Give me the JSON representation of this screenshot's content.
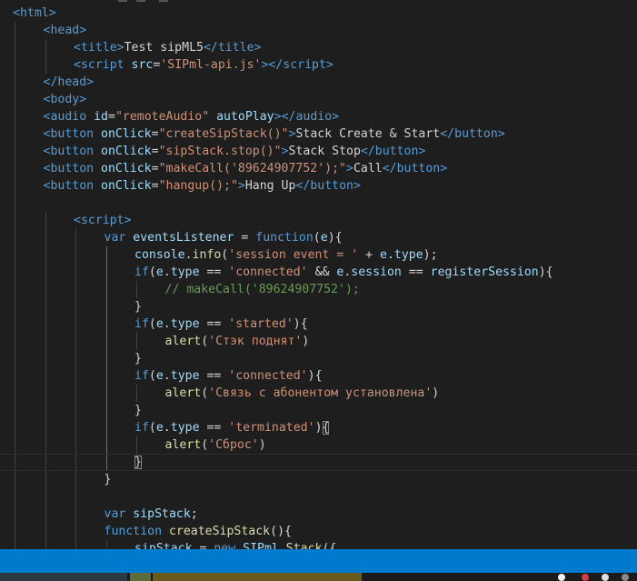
{
  "editor": {
    "lines": [
      {
        "indent": 0,
        "tokens": [
          {
            "t": "<",
            "c": "tag"
          },
          {
            "t": "html",
            "c": "tag"
          },
          {
            "t": ">",
            "c": "tag"
          }
        ]
      },
      {
        "indent": 1,
        "tokens": [
          {
            "t": "<",
            "c": "tag"
          },
          {
            "t": "head",
            "c": "tag"
          },
          {
            "t": ">",
            "c": "tag"
          }
        ]
      },
      {
        "indent": 2,
        "tokens": [
          {
            "t": "<",
            "c": "tag"
          },
          {
            "t": "title",
            "c": "tag"
          },
          {
            "t": ">",
            "c": "tag"
          },
          {
            "t": "Test sipML5",
            "c": "text"
          },
          {
            "t": "</",
            "c": "tag"
          },
          {
            "t": "title",
            "c": "tag"
          },
          {
            "t": ">",
            "c": "tag"
          }
        ]
      },
      {
        "indent": 2,
        "tokens": [
          {
            "t": "<",
            "c": "tag"
          },
          {
            "t": "script ",
            "c": "tag"
          },
          {
            "t": "src",
            "c": "attr"
          },
          {
            "t": "=",
            "c": "text"
          },
          {
            "t": "'SIPml-api.js'",
            "c": "str"
          },
          {
            "t": "></",
            "c": "tag"
          },
          {
            "t": "script",
            "c": "tag"
          },
          {
            "t": ">",
            "c": "tag"
          }
        ]
      },
      {
        "indent": 1,
        "tokens": [
          {
            "t": "</",
            "c": "tag"
          },
          {
            "t": "head",
            "c": "tag"
          },
          {
            "t": ">",
            "c": "tag"
          }
        ]
      },
      {
        "indent": 1,
        "tokens": [
          {
            "t": "<",
            "c": "tag"
          },
          {
            "t": "body",
            "c": "tag"
          },
          {
            "t": ">",
            "c": "tag"
          }
        ]
      },
      {
        "indent": 1,
        "tokens": [
          {
            "t": "<",
            "c": "tag"
          },
          {
            "t": "audio ",
            "c": "tag"
          },
          {
            "t": "id",
            "c": "attr"
          },
          {
            "t": "=",
            "c": "text"
          },
          {
            "t": "\"remoteAudio\"",
            "c": "str"
          },
          {
            "t": " ",
            "c": "text"
          },
          {
            "t": "autoPlay",
            "c": "attr"
          },
          {
            "t": "></",
            "c": "tag"
          },
          {
            "t": "audio",
            "c": "tag"
          },
          {
            "t": ">",
            "c": "tag"
          }
        ]
      },
      {
        "indent": 1,
        "tokens": [
          {
            "t": "<",
            "c": "tag"
          },
          {
            "t": "button ",
            "c": "tag"
          },
          {
            "t": "onClick",
            "c": "attr"
          },
          {
            "t": "=",
            "c": "text"
          },
          {
            "t": "\"createSipStack()\"",
            "c": "str"
          },
          {
            "t": ">",
            "c": "tag"
          },
          {
            "t": "Stack Create & Start",
            "c": "text"
          },
          {
            "t": "</",
            "c": "tag"
          },
          {
            "t": "button",
            "c": "tag"
          },
          {
            "t": ">",
            "c": "tag"
          }
        ]
      },
      {
        "indent": 1,
        "tokens": [
          {
            "t": "<",
            "c": "tag"
          },
          {
            "t": "button ",
            "c": "tag"
          },
          {
            "t": "onClick",
            "c": "attr"
          },
          {
            "t": "=",
            "c": "text"
          },
          {
            "t": "\"sipStack.stop()\"",
            "c": "str"
          },
          {
            "t": ">",
            "c": "tag"
          },
          {
            "t": "Stack Stop",
            "c": "text"
          },
          {
            "t": "</",
            "c": "tag"
          },
          {
            "t": "button",
            "c": "tag"
          },
          {
            "t": ">",
            "c": "tag"
          }
        ]
      },
      {
        "indent": 1,
        "tokens": [
          {
            "t": "<",
            "c": "tag"
          },
          {
            "t": "button ",
            "c": "tag"
          },
          {
            "t": "onClick",
            "c": "attr"
          },
          {
            "t": "=",
            "c": "text"
          },
          {
            "t": "\"makeCall('89624907752');\"",
            "c": "str"
          },
          {
            "t": ">",
            "c": "tag"
          },
          {
            "t": "Call",
            "c": "text"
          },
          {
            "t": "</",
            "c": "tag"
          },
          {
            "t": "button",
            "c": "tag"
          },
          {
            "t": ">",
            "c": "tag"
          }
        ]
      },
      {
        "indent": 1,
        "tokens": [
          {
            "t": "<",
            "c": "tag"
          },
          {
            "t": "button ",
            "c": "tag"
          },
          {
            "t": "onClick",
            "c": "attr"
          },
          {
            "t": "=",
            "c": "text"
          },
          {
            "t": "\"hangup();\"",
            "c": "str"
          },
          {
            "t": ">",
            "c": "tag"
          },
          {
            "t": "Hang Up",
            "c": "text"
          },
          {
            "t": "</",
            "c": "tag"
          },
          {
            "t": "button",
            "c": "tag"
          },
          {
            "t": ">",
            "c": "tag"
          }
        ]
      },
      {
        "indent": 0,
        "tokens": []
      },
      {
        "indent": 2,
        "tokens": [
          {
            "t": "<",
            "c": "tag"
          },
          {
            "t": "script",
            "c": "tag"
          },
          {
            "t": ">",
            "c": "tag"
          }
        ]
      },
      {
        "indent": 3,
        "tokens": [
          {
            "t": "var ",
            "c": "kw"
          },
          {
            "t": "eventsListener",
            "c": "var"
          },
          {
            "t": " = ",
            "c": "text"
          },
          {
            "t": "function",
            "c": "kw"
          },
          {
            "t": "(",
            "c": "text"
          },
          {
            "t": "e",
            "c": "var"
          },
          {
            "t": "){",
            "c": "text"
          }
        ]
      },
      {
        "indent": 4,
        "tokens": [
          {
            "t": "console",
            "c": "var"
          },
          {
            "t": ".",
            "c": "text"
          },
          {
            "t": "info",
            "c": "fn"
          },
          {
            "t": "(",
            "c": "text"
          },
          {
            "t": "'session event = '",
            "c": "str"
          },
          {
            "t": " + ",
            "c": "text"
          },
          {
            "t": "e",
            "c": "var"
          },
          {
            "t": ".",
            "c": "text"
          },
          {
            "t": "type",
            "c": "var"
          },
          {
            "t": ");",
            "c": "text"
          }
        ]
      },
      {
        "indent": 4,
        "tokens": [
          {
            "t": "if",
            "c": "kw"
          },
          {
            "t": "(",
            "c": "text"
          },
          {
            "t": "e",
            "c": "var"
          },
          {
            "t": ".",
            "c": "text"
          },
          {
            "t": "type",
            "c": "var"
          },
          {
            "t": " == ",
            "c": "text"
          },
          {
            "t": "'connected'",
            "c": "str"
          },
          {
            "t": " && ",
            "c": "text"
          },
          {
            "t": "e",
            "c": "var"
          },
          {
            "t": ".",
            "c": "text"
          },
          {
            "t": "session",
            "c": "var"
          },
          {
            "t": " == ",
            "c": "text"
          },
          {
            "t": "registerSession",
            "c": "var"
          },
          {
            "t": "){",
            "c": "text"
          }
        ]
      },
      {
        "indent": 5,
        "tokens": [
          {
            "t": "// makeCall('89624907752');",
            "c": "com"
          }
        ]
      },
      {
        "indent": 4,
        "tokens": [
          {
            "t": "}",
            "c": "text"
          }
        ]
      },
      {
        "indent": 4,
        "tokens": [
          {
            "t": "if",
            "c": "kw"
          },
          {
            "t": "(",
            "c": "text"
          },
          {
            "t": "e",
            "c": "var"
          },
          {
            "t": ".",
            "c": "text"
          },
          {
            "t": "type",
            "c": "var"
          },
          {
            "t": " == ",
            "c": "text"
          },
          {
            "t": "'started'",
            "c": "str"
          },
          {
            "t": "){",
            "c": "text"
          }
        ]
      },
      {
        "indent": 5,
        "tokens": [
          {
            "t": "alert",
            "c": "fn"
          },
          {
            "t": "(",
            "c": "text"
          },
          {
            "t": "'Стэк поднят'",
            "c": "str"
          },
          {
            "t": ")",
            "c": "text"
          }
        ]
      },
      {
        "indent": 4,
        "tokens": [
          {
            "t": "}",
            "c": "text"
          }
        ]
      },
      {
        "indent": 4,
        "tokens": [
          {
            "t": "if",
            "c": "kw"
          },
          {
            "t": "(",
            "c": "text"
          },
          {
            "t": "e",
            "c": "var"
          },
          {
            "t": ".",
            "c": "text"
          },
          {
            "t": "type",
            "c": "var"
          },
          {
            "t": " == ",
            "c": "text"
          },
          {
            "t": "'connected'",
            "c": "str"
          },
          {
            "t": "){",
            "c": "text"
          }
        ]
      },
      {
        "indent": 5,
        "tokens": [
          {
            "t": "alert",
            "c": "fn"
          },
          {
            "t": "(",
            "c": "text"
          },
          {
            "t": "'Связь с абонентом установлена'",
            "c": "str"
          },
          {
            "t": ")",
            "c": "text"
          }
        ]
      },
      {
        "indent": 4,
        "tokens": [
          {
            "t": "}",
            "c": "text"
          }
        ]
      },
      {
        "indent": 4,
        "tokens": [
          {
            "t": "if",
            "c": "kw"
          },
          {
            "t": "(",
            "c": "text"
          },
          {
            "t": "e",
            "c": "var"
          },
          {
            "t": ".",
            "c": "text"
          },
          {
            "t": "type",
            "c": "var"
          },
          {
            "t": " == ",
            "c": "text"
          },
          {
            "t": "'terminated'",
            "c": "str"
          },
          {
            "t": ")",
            "c": "text"
          },
          {
            "t": "{",
            "c": "match"
          }
        ]
      },
      {
        "indent": 5,
        "tokens": [
          {
            "t": "alert",
            "c": "fn"
          },
          {
            "t": "(",
            "c": "text"
          },
          {
            "t": "'Сброс'",
            "c": "str"
          },
          {
            "t": ")",
            "c": "text"
          }
        ]
      },
      {
        "indent": 4,
        "current": true,
        "tokens": [
          {
            "t": "}",
            "c": "match"
          }
        ]
      },
      {
        "indent": 3,
        "tokens": [
          {
            "t": "}",
            "c": "text"
          }
        ]
      },
      {
        "indent": 0,
        "tokens": []
      },
      {
        "indent": 3,
        "tokens": [
          {
            "t": "var ",
            "c": "kw"
          },
          {
            "t": "sipStack",
            "c": "var"
          },
          {
            "t": ";",
            "c": "text"
          }
        ]
      },
      {
        "indent": 3,
        "tokens": [
          {
            "t": "function ",
            "c": "kw"
          },
          {
            "t": "createSipStack",
            "c": "fn"
          },
          {
            "t": "(){",
            "c": "text"
          }
        ]
      },
      {
        "indent": 4,
        "tokens": [
          {
            "t": "sipStack",
            "c": "var"
          },
          {
            "t": " = ",
            "c": "text"
          },
          {
            "t": "new ",
            "c": "kw"
          },
          {
            "t": "SIPml",
            "c": "var"
          },
          {
            "t": ".",
            "c": "text"
          },
          {
            "t": "Stack",
            "c": "fn"
          },
          {
            "t": "({",
            "c": "text"
          }
        ]
      }
    ]
  },
  "colors": {
    "background": "#1e1e1e",
    "statusbar": "#007acc",
    "tag": "#569cd6",
    "attr": "#9cdcfe",
    "string": "#ce9178",
    "function": "#dcdcaa",
    "comment": "#6a9955"
  }
}
